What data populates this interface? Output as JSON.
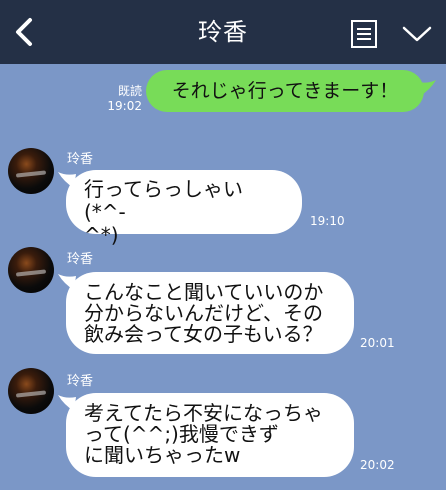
{
  "header": {
    "title": "玲香"
  },
  "messages": [
    {
      "direction": "outgoing",
      "read_label": "既読",
      "time": "19:02",
      "text": "それじゃ行ってきまーす！"
    },
    {
      "direction": "incoming",
      "sender": "玲香",
      "lines": [
        "行ってらっしゃい(*^-",
        "^*)"
      ],
      "time": "19:10"
    },
    {
      "direction": "incoming",
      "sender": "玲香",
      "lines": [
        "こんなこと聞いていいのか",
        "分からないんだけど、その",
        "飲み会って女の子もいる？"
      ],
      "time": "20:01"
    },
    {
      "direction": "incoming",
      "sender": "玲香",
      "lines": [
        "考えてたら不安になっちゃ",
        "って(^^;)我慢できず",
        "に聞いちゃったw"
      ],
      "time": "20:02"
    }
  ],
  "colors": {
    "background": "#7b97c7",
    "header": "#243046",
    "outgoing_bubble": "#78dc58",
    "incoming_bubble": "#ffffff"
  },
  "icons": {
    "back": "chevron-left-icon",
    "menu": "notes-icon",
    "more": "chevron-down-icon"
  }
}
